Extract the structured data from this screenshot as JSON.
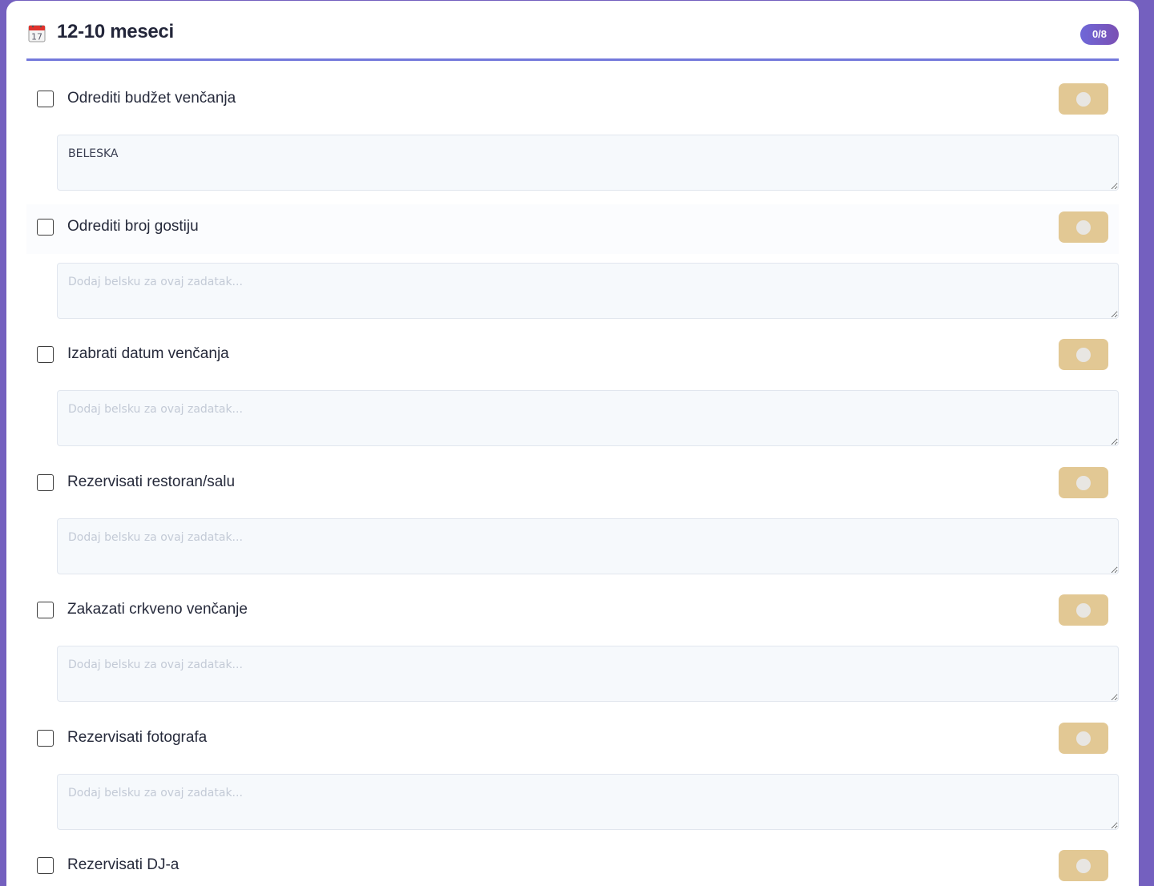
{
  "section": {
    "icon": "calendar-icon",
    "icon_text": "17",
    "title": "12-10 meseci",
    "progress": "0/8",
    "accent_color": "#7479dc",
    "background_color": "#7460bf",
    "toggle_color": "#e2c894"
  },
  "tasks": [
    {
      "label": "Odrediti budžet venčanja",
      "checked": false,
      "note_value": "BELESKA",
      "note_placeholder": "Dodaj belsku za ovaj zadatak..."
    },
    {
      "label": "Odrediti broj gostiju",
      "checked": false,
      "note_value": "",
      "note_placeholder": "Dodaj belsku za ovaj zadatak..."
    },
    {
      "label": "Izabrati datum venčanja",
      "checked": false,
      "note_value": "",
      "note_placeholder": "Dodaj belsku za ovaj zadatak..."
    },
    {
      "label": "Rezervisati restoran/salu",
      "checked": false,
      "note_value": "",
      "note_placeholder": "Dodaj belsku za ovaj zadatak..."
    },
    {
      "label": "Zakazati crkveno venčanje",
      "checked": false,
      "note_value": "",
      "note_placeholder": "Dodaj belsku za ovaj zadatak..."
    },
    {
      "label": "Rezervisati fotografa",
      "checked": false,
      "note_value": "",
      "note_placeholder": "Dodaj belsku za ovaj zadatak..."
    },
    {
      "label": "Rezervisati DJ-a",
      "checked": false,
      "note_value": "",
      "note_placeholder": "Dodaj belsku za ovaj zadatak..."
    }
  ]
}
